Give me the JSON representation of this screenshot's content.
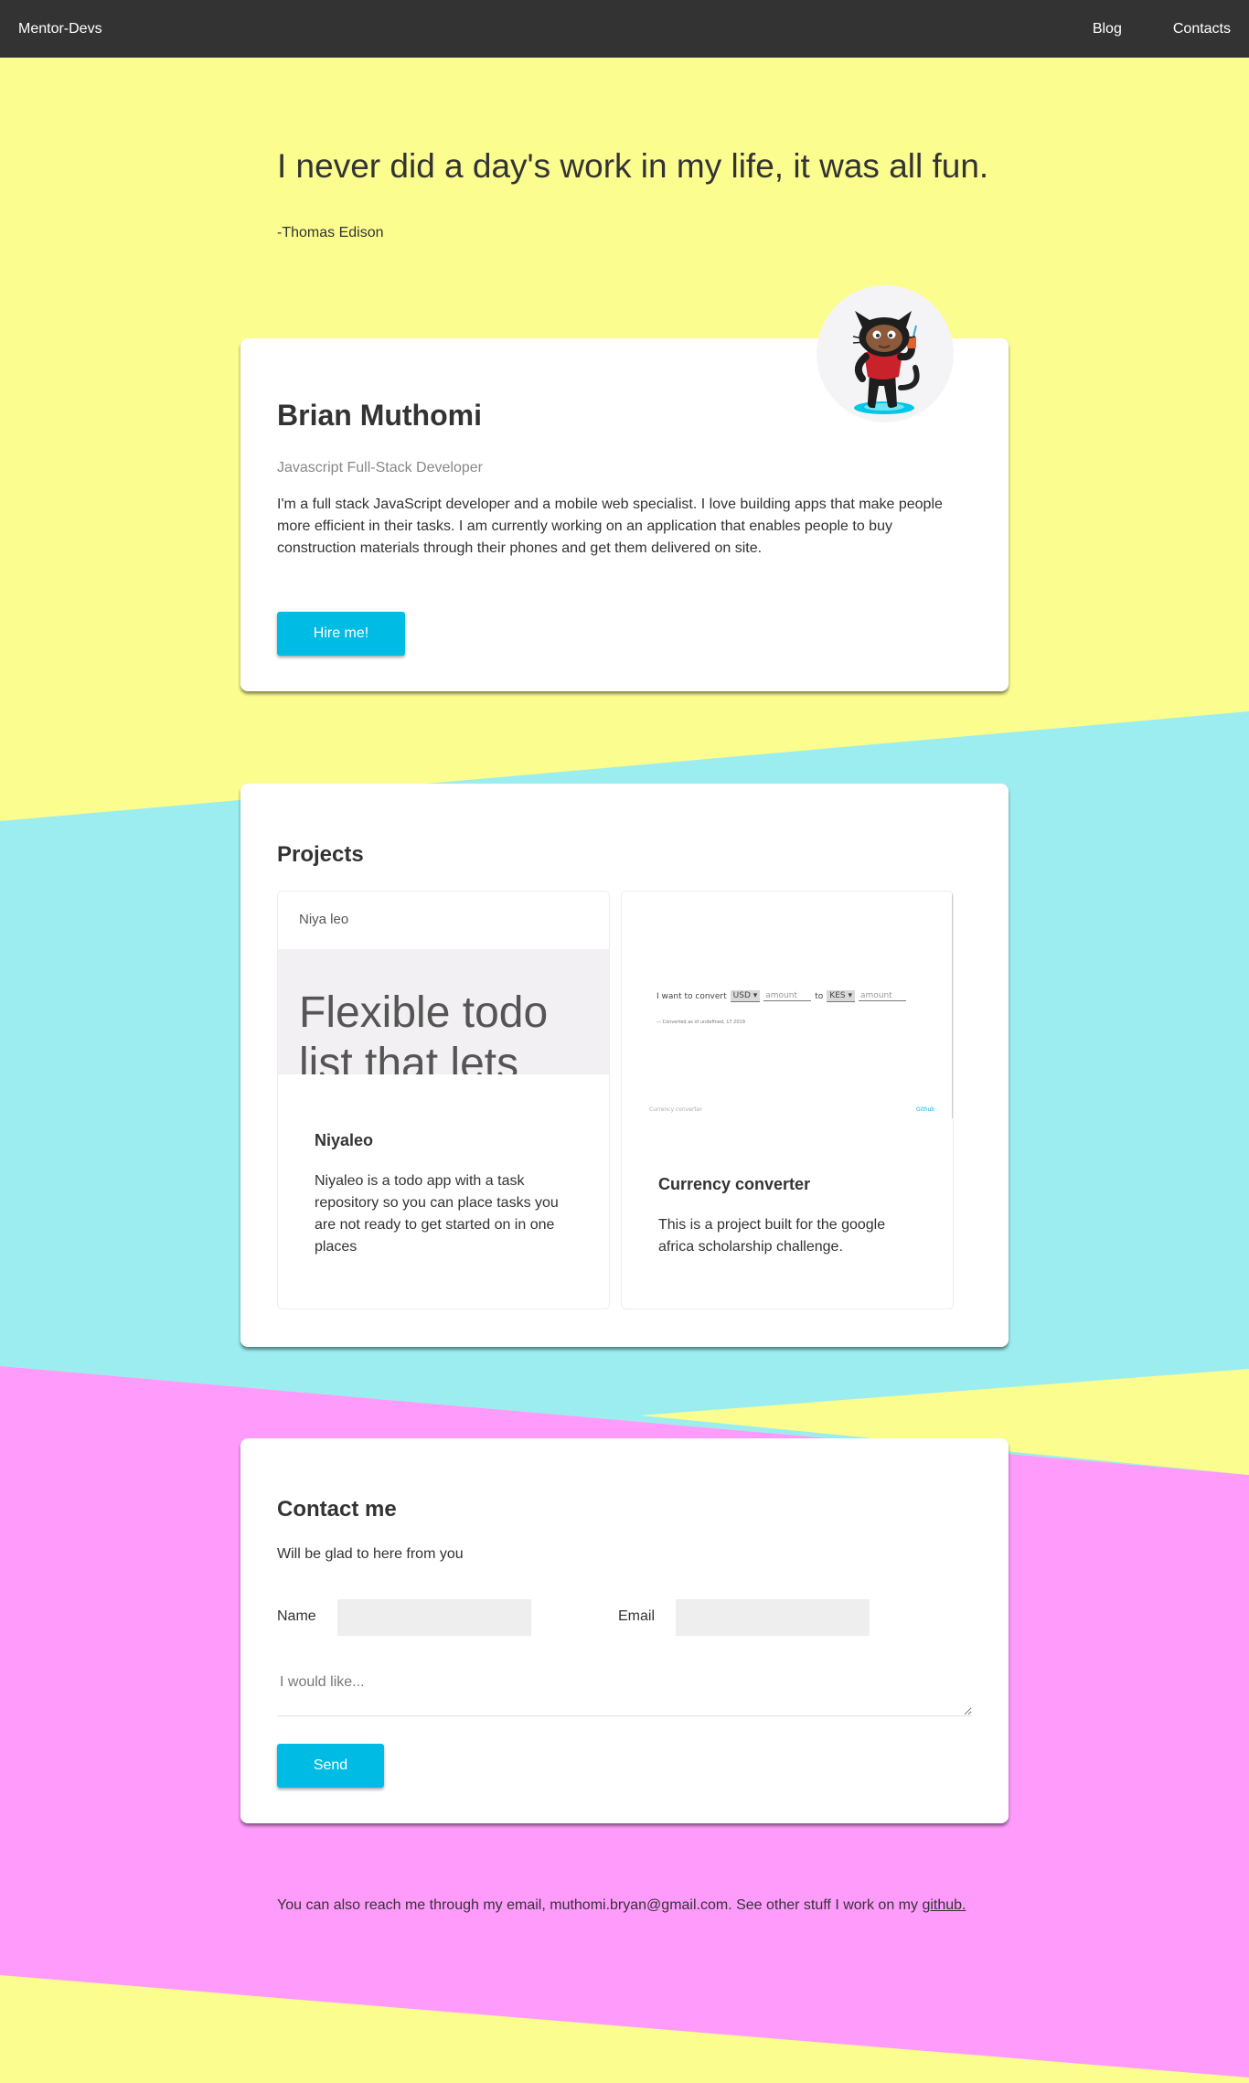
{
  "colors": {
    "nav_bg": "#333333",
    "yellow": "#fbfd8f",
    "cyan": "#9bedf0",
    "pink": "#fe9bfb",
    "accent": "#00bce4",
    "text": "#333333",
    "muted": "#888888",
    "input_bg": "#eeeeee"
  },
  "nav": {
    "brand": "Mentor-Devs",
    "links": [
      {
        "label": "Blog"
      },
      {
        "label": "Contacts"
      }
    ]
  },
  "quote": {
    "text": "I never did a day's work in my life, it was all fun.",
    "author": "-Thomas Edison"
  },
  "profile": {
    "avatar_icon": "octocat-avatar-icon",
    "name": "Brian Muthomi",
    "role": "Javascript Full-Stack Developer",
    "bio": "I'm a full stack JavaScript developer and a mobile web specialist. I love building apps that make people more efficient in their tasks. I am currently working on an application that enables people to buy construction materials through their phones and get them delivered on site.",
    "hire_label": "Hire me!"
  },
  "projects": {
    "title": "Projects",
    "items": [
      {
        "preview": {
          "site_title": "Niya leo",
          "hero_text": "Flexible todo list that lets"
        },
        "title": "Niyaleo",
        "description": "Niyaleo is a todo app with a task repository so you can place tasks you are not ready to get started on in one places"
      },
      {
        "preview": {
          "prefix": "I want to convert",
          "from_currency": "USD ▾",
          "amount_placeholder": "amount",
          "connector": "to",
          "to_currency": "KES ▾",
          "amount_placeholder_2": "amount",
          "note": "— Converted as of undefined, 17 2019",
          "footer_left": "Currency converter",
          "footer_right": "Github"
        },
        "title": "Currency converter",
        "description": "This is a project built for the google africa scholarship challenge."
      }
    ]
  },
  "contact": {
    "title": "Contact me",
    "subtitle": "Will be glad to here from you",
    "name_label": "Name",
    "name_value": "",
    "email_label": "Email",
    "email_value": "",
    "message_placeholder": "I would like...",
    "send_label": "Send"
  },
  "footer": {
    "text": "You can also reach me through my email, muthomi.bryan@gmail.com. See other stuff I work on my ",
    "link_label": "github."
  }
}
